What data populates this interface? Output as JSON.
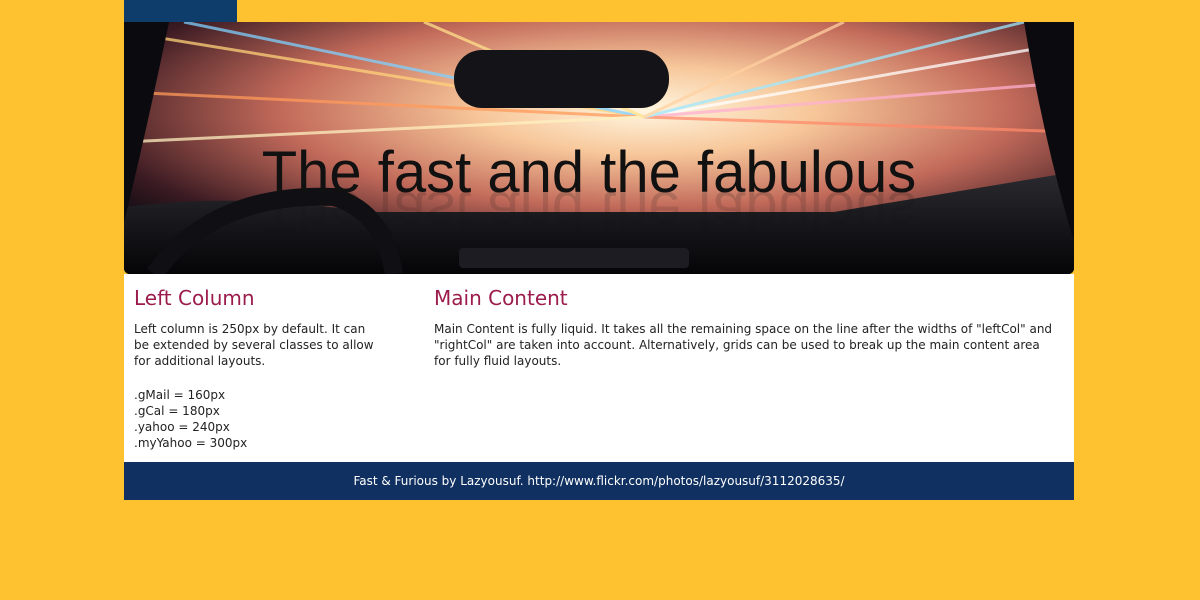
{
  "colors": {
    "background": "#fec12f",
    "nav_accent": "#0f3d6b",
    "heading": "#9b1c4c",
    "footer_bg": "#0f3060"
  },
  "hero": {
    "title": "The fast and the fabulous"
  },
  "left_column": {
    "heading": "Left Column",
    "paragraph": "Left column is 250px by default. It can be extended by several classes to allow for additional layouts.",
    "layout_classes": [
      ".gMail = 160px",
      ".gCal = 180px",
      ".yahoo = 240px",
      ".myYahoo = 300px"
    ]
  },
  "main_content": {
    "heading": "Main Content",
    "paragraph": "Main Content is fully liquid. It takes all the remaining space on the line after the widths of \"leftCol\" and \"rightCol\" are taken into account. Alternatively, grids can be used to break up the main content area for fully fluid layouts."
  },
  "footer": {
    "credit": "Fast & Furious by Lazyousuf. http://www.flickr.com/photos/lazyousuf/3112028635/"
  }
}
